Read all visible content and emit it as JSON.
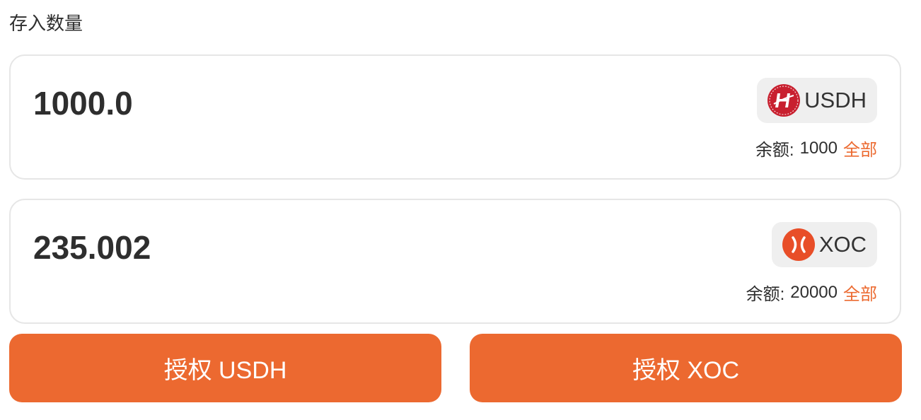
{
  "section_label": "存入数量",
  "inputs": [
    {
      "amount": "1000.0",
      "token": "USDH",
      "token_icon": "usdh-logo-icon",
      "token_color": "#c8202f",
      "balance_label": "余额:",
      "balance_value": "1000",
      "max_label": "全部"
    },
    {
      "amount": "235.002",
      "token": "XOC",
      "token_icon": "xoc-logo-icon",
      "token_color": "#e84e28",
      "balance_label": "余额:",
      "balance_value": "20000",
      "max_label": "全部"
    }
  ],
  "buttons": [
    {
      "label": "授权 USDH"
    },
    {
      "label": "授权 XOC"
    }
  ],
  "colors": {
    "accent": "#ec6930",
    "pill_bg": "#efefef",
    "card_border": "#e6e6e6"
  }
}
